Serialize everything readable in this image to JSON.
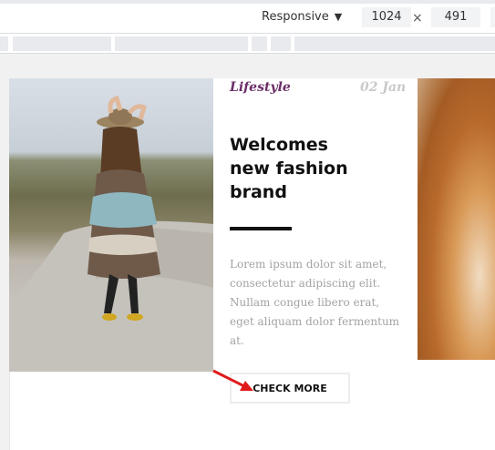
{
  "devtools": {
    "device": "Responsive",
    "width": "1024",
    "times": "×",
    "height": "491"
  },
  "card": {
    "category": "Lifestyle",
    "date": "02 Jan",
    "title_line1": "Welcomes",
    "title_line2": "new fashion",
    "title_line3": "brand",
    "body": "Lorem ipsum dolor sit amet, consectetur adipiscing elit. Nullam congue libero erat, eget aliquam dolor fermentum at.",
    "button": "CHECK MORE"
  },
  "colors": {
    "category": "#6b2e67",
    "annotation_arrow": "#e0191a"
  },
  "icons": {
    "dropdown": "caret-down-icon",
    "annotation": "red-arrow-icon"
  }
}
